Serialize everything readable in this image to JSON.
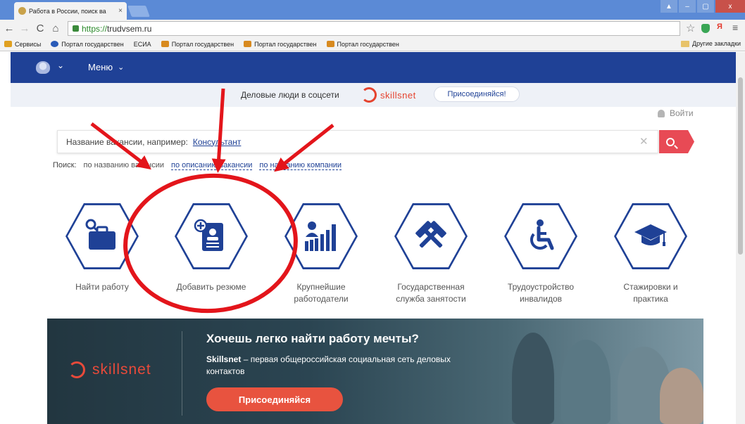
{
  "browser": {
    "tab_title": "Работа в России, поиск ва",
    "tab_close": "×",
    "window_controls": [
      "▲",
      "–",
      "▢",
      "x"
    ],
    "url_scheme": "https://",
    "url_host": "trudvsem.ru",
    "bookmarks": [
      {
        "label": "Сервисы",
        "color": "#e0a020"
      },
      {
        "label": "Портал государствен",
        "color": "#2a5bb8"
      },
      {
        "label": "ЕСИА",
        "color": ""
      },
      {
        "label": "Портал государствен",
        "color": "#d88a1f"
      },
      {
        "label": "Портал государствен",
        "color": "#d88a1f"
      },
      {
        "label": "Портал государствен",
        "color": "#d88a1f"
      }
    ],
    "other_bookmarks": "Другие закладки"
  },
  "site": {
    "menu_label": "Меню",
    "promo_text": "Деловые люди в соцсети",
    "brand": "skillsnet",
    "promo_button": "Присоединяйся!",
    "login": "Войти"
  },
  "search": {
    "prefix": "Название вакансии, например:",
    "example": "Консультант",
    "mode_label": "Поиск:",
    "mode_options": [
      "по названию вакансии",
      "по описанию вакансии",
      "по названию компании"
    ]
  },
  "tiles": [
    {
      "icon": "briefcase-search-icon",
      "label": "Найти работу"
    },
    {
      "icon": "add-resume-icon",
      "label": "Добавить резюме"
    },
    {
      "icon": "employers-chart-icon",
      "label": "Крупнейшие работодатели"
    },
    {
      "icon": "hammers-icon",
      "label": "Государственная служба занятости"
    },
    {
      "icon": "wheelchair-icon",
      "label": "Трудоустройство инвалидов"
    },
    {
      "icon": "graduation-cap-icon",
      "label": "Стажировки и практика"
    }
  ],
  "banner": {
    "title": "Хочешь легко найти работу мечты?",
    "brand": "Skillsnet",
    "text": " – первая общероссийская социальная сеть деловых контактов",
    "button": "Присоединяйся",
    "logo_word": "skillsnet"
  },
  "colors": {
    "primary": "#1f4196",
    "accent": "#e84a55",
    "annotation": "#e3151b"
  }
}
